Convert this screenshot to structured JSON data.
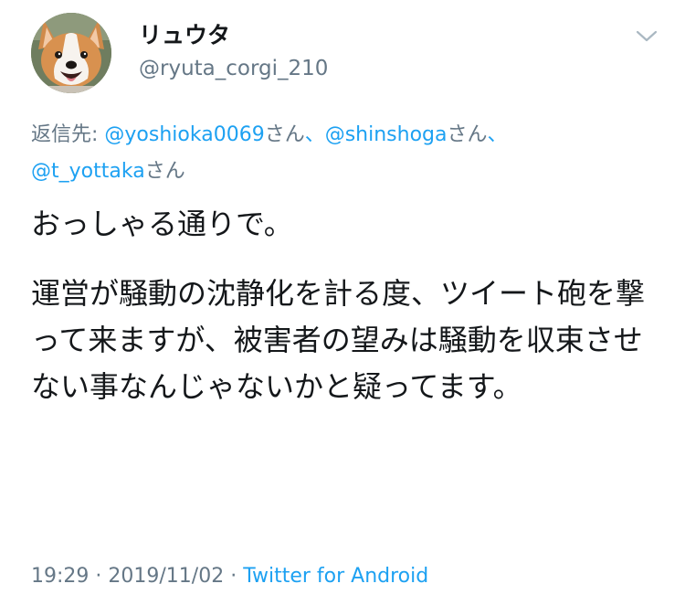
{
  "user": {
    "display_name": "リュウタ",
    "username": "@ryuta_corgi_210",
    "avatar_icon": "corgi-avatar"
  },
  "menu": {
    "icon": "chevron-down-icon"
  },
  "reply": {
    "prefix": "返信先: ",
    "mentions": [
      {
        "handle": "@yoshioka0069",
        "suffix": "さん"
      },
      {
        "handle": "@shinshoga",
        "suffix": "さん"
      },
      {
        "handle": "@t_yottaka",
        "suffix": "さん"
      }
    ],
    "separator": "、"
  },
  "tweet": {
    "line1": "おっしゃる通りで。",
    "line2": "運営が騒動の沈静化を計る度、ツイート砲を撃って来ますが、被害者の望みは騒動を収束させない事なんじゃないかと疑ってます。"
  },
  "meta": {
    "time": "19:29",
    "dot1": " · ",
    "date": "2019/11/02",
    "dot2": " · ",
    "source": "Twitter for Android"
  },
  "colors": {
    "link": "#1da1f2",
    "secondary_text": "#657786",
    "primary_text": "#14171a"
  }
}
